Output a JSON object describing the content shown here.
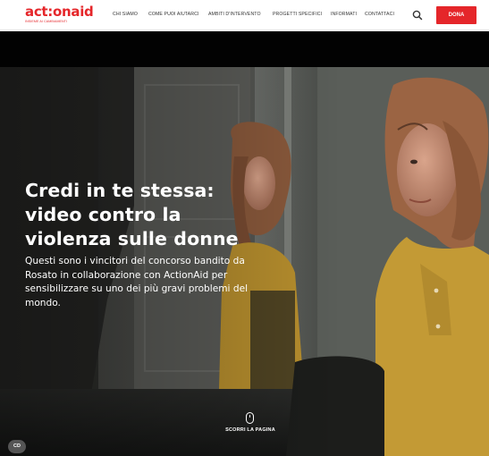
{
  "brand": {
    "logo_text": "act:onaid",
    "logo_tagline": "INSIEME AI CAMBIAMENTI",
    "accent_color": "#e5262a"
  },
  "nav": {
    "items": [
      "CHI SIAMO",
      "COME PUOI AIUTARCI",
      "AMBITI D'INTERVENTO",
      "PROGETTI SPECIFICI",
      "INFORMATI",
      "CONTATTACI"
    ],
    "search_icon": "search-icon",
    "donate_label": "DONA"
  },
  "hero": {
    "title_lines": [
      "Credi in te stessa:",
      "video contro la",
      "violenza sulle donne"
    ],
    "description_lines": [
      "Questi sono i vincitori del concorso bandito da",
      "Rosato in collaborazione con ActionAid per",
      "sensibilizzare su uno dei più gravi problemi del",
      "mondo."
    ],
    "scroll_label": "SCORRI LA PAGINA",
    "scroll_icon": "mouse-icon",
    "cc_label": "CD"
  }
}
